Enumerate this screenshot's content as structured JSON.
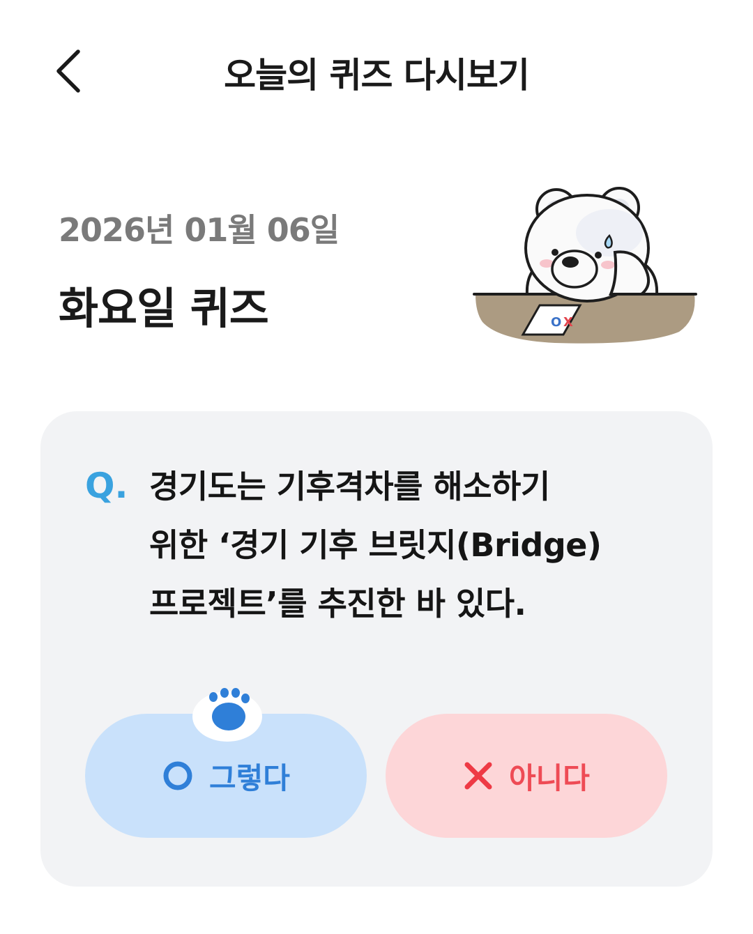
{
  "header": {
    "title": "오늘의 퀴즈 다시보기",
    "back_icon": "chevron-left-icon"
  },
  "quiz": {
    "date": "2026년 01월 06일",
    "day_title": "화요일 퀴즈",
    "question_prefix": "Q.",
    "question_lines": [
      "경기도는 기후격차를 해소하기",
      "위한 ‘경기 기후 브릿지(Bridge)",
      "프로젝트’를 추진한 바 있다."
    ],
    "mascot": {
      "icon": "polar-bear-quiz-illustration",
      "paper_text": "OX"
    }
  },
  "answers": {
    "yes": {
      "label": "그렇다",
      "icon": "circle-o-icon",
      "color": "#2f7fd8",
      "background": "#c9e1fb"
    },
    "no": {
      "label": "아니다",
      "icon": "cross-x-icon",
      "color": "#ee4b55",
      "background": "#fdd6d8"
    },
    "selection_marker_icon": "paw-icon"
  },
  "colors": {
    "accent": "#3aa2df",
    "card_background": "#f2f3f5"
  }
}
